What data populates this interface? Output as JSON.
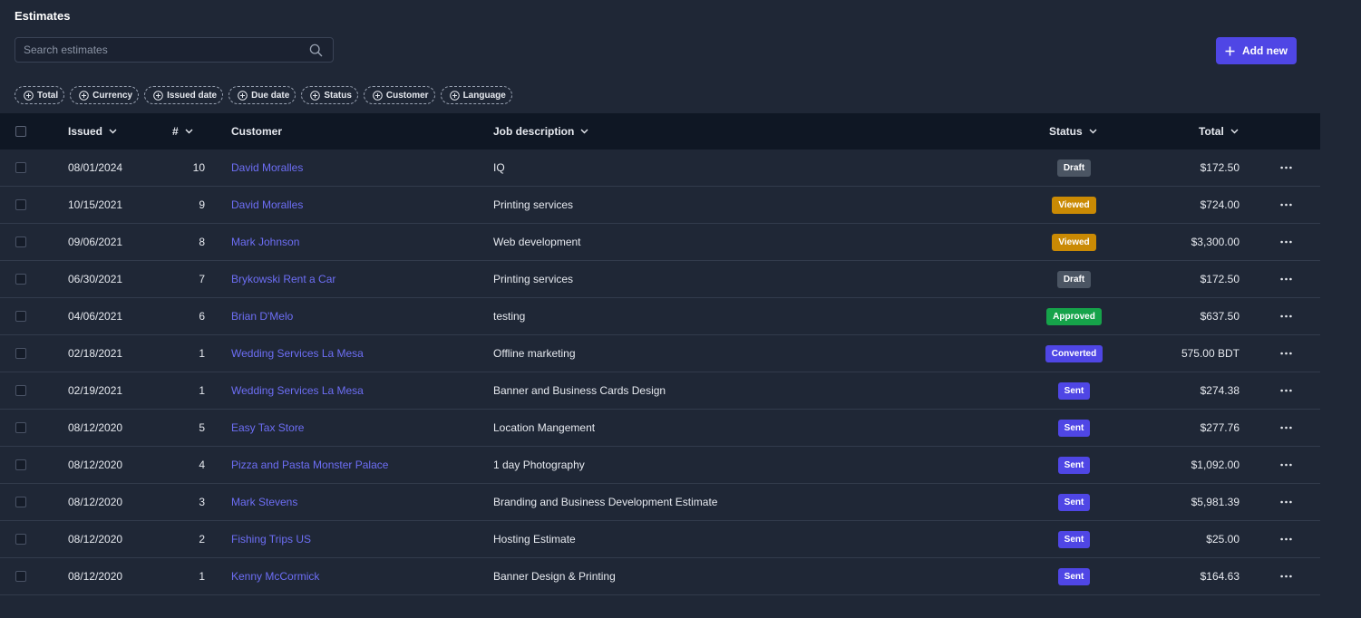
{
  "page": {
    "title": "Estimates"
  },
  "search": {
    "placeholder": "Search estimates",
    "value": ""
  },
  "toolbar": {
    "add_label": "Add new"
  },
  "filters": [
    {
      "label": "Total"
    },
    {
      "label": "Currency"
    },
    {
      "label": "Issued date"
    },
    {
      "label": "Due date"
    },
    {
      "label": "Status"
    },
    {
      "label": "Customer"
    },
    {
      "label": "Language"
    }
  ],
  "columns": {
    "issued": "Issued",
    "number": "#",
    "customer": "Customer",
    "job": "Job description",
    "status": "Status",
    "total": "Total"
  },
  "status_colors": {
    "Draft": "#4b5563",
    "Viewed": "#ca8a04",
    "Approved": "#16a34a",
    "Converted": "#4f46e5",
    "Sent": "#4f46e5"
  },
  "rows": [
    {
      "issued": "08/01/2024",
      "number": "10",
      "customer": "David Moralles",
      "job": "IQ",
      "status": "Draft",
      "total": "$172.50"
    },
    {
      "issued": "10/15/2021",
      "number": "9",
      "customer": "David Moralles",
      "job": "Printing services",
      "status": "Viewed",
      "total": "$724.00"
    },
    {
      "issued": "09/06/2021",
      "number": "8",
      "customer": "Mark Johnson",
      "job": "Web development",
      "status": "Viewed",
      "total": "$3,300.00"
    },
    {
      "issued": "06/30/2021",
      "number": "7",
      "customer": "Brykowski Rent a Car",
      "job": "Printing services",
      "status": "Draft",
      "total": "$172.50"
    },
    {
      "issued": "04/06/2021",
      "number": "6",
      "customer": "Brian D'Melo",
      "job": "testing",
      "status": "Approved",
      "total": "$637.50"
    },
    {
      "issued": "02/18/2021",
      "number": "1",
      "customer": "Wedding Services La Mesa",
      "job": "Offline marketing",
      "status": "Converted",
      "total": "575.00 BDT"
    },
    {
      "issued": "02/19/2021",
      "number": "1",
      "customer": "Wedding Services La Mesa",
      "job": "Banner and Business Cards Design",
      "status": "Sent",
      "total": "$274.38"
    },
    {
      "issued": "08/12/2020",
      "number": "5",
      "customer": "Easy Tax Store",
      "job": "Location Mangement",
      "status": "Sent",
      "total": "$277.76"
    },
    {
      "issued": "08/12/2020",
      "number": "4",
      "customer": "Pizza and Pasta Monster Palace",
      "job": "1 day Photography",
      "status": "Sent",
      "total": "$1,092.00"
    },
    {
      "issued": "08/12/2020",
      "number": "3",
      "customer": "Mark Stevens",
      "job": "Branding and Business Development Estimate",
      "status": "Sent",
      "total": "$5,981.39"
    },
    {
      "issued": "08/12/2020",
      "number": "2",
      "customer": "Fishing Trips US",
      "job": "Hosting Estimate",
      "status": "Sent",
      "total": "$25.00"
    },
    {
      "issued": "08/12/2020",
      "number": "1",
      "customer": "Kenny McCormick",
      "job": "Banner Design & Printing",
      "status": "Sent",
      "total": "$164.63"
    }
  ]
}
